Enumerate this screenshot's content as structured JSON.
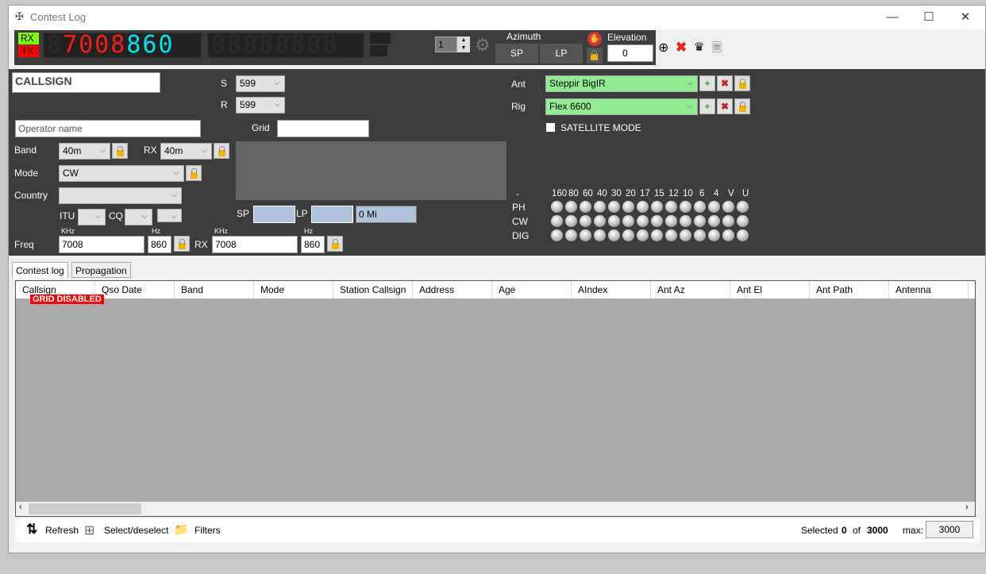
{
  "window": {
    "title": "Contest Log",
    "minimize": "—",
    "maximize": "☐",
    "close": "✕"
  },
  "toolbar": {
    "rx": "RX",
    "tx": "TX",
    "freq_khz": "7008",
    "freq_hz": "860",
    "spinner": "1",
    "azimuth": "Azimuth",
    "sp": "SP",
    "lp": "LP",
    "elevation": "Elevation",
    "elevation_value": "0"
  },
  "entry": {
    "callsign_placeholder": "CALLSIGN",
    "operator_placeholder": "Operator name",
    "s_label": "S",
    "s_value": "599",
    "r_label": "R",
    "r_value": "599",
    "grid_label": "Grid",
    "grid_value": "",
    "band_label": "Band",
    "band_value": "40m",
    "rx_label": "RX",
    "rx_band_value": "40m",
    "mode_label": "Mode",
    "mode_value": "CW",
    "country_label": "Country",
    "country_value": "",
    "itu_label": "ITU",
    "cq_label": "CQ",
    "sp_label": "SP",
    "lp_label": "LP",
    "distance": "0 Mi",
    "freq_label": "Freq",
    "khz": "KHz",
    "hz": "Hz",
    "freq_khz": "7008",
    "freq_hz": "860",
    "rx_freq_label": "RX",
    "rx_freq_khz": "7008",
    "rx_freq_hz": "860"
  },
  "station": {
    "ant_label": "Ant",
    "ant_value": "Steppir BigIR",
    "rig_label": "Rig",
    "rig_value": "Flex 6600",
    "satellite_mode": "SATELLITE MODE"
  },
  "band_matrix": {
    "corner": "-",
    "bands": [
      "160",
      "80",
      "60",
      "40",
      "30",
      "20",
      "17",
      "15",
      "12",
      "10",
      "6",
      "4",
      "V",
      "U"
    ],
    "modes": [
      "PH",
      "CW",
      "DIG"
    ]
  },
  "tabs": [
    {
      "label": "Contest log",
      "active": true
    },
    {
      "label": "Propagation",
      "active": false
    }
  ],
  "grid": {
    "columns": [
      "Callsign",
      "Qso Date",
      "Band",
      "Mode",
      "Station Callsign",
      "Address",
      "Age",
      "AIndex",
      "Ant Az",
      "Ant El",
      "Ant Path",
      "Antenna"
    ],
    "badge": "GRID DISABLED"
  },
  "footer": {
    "refresh": "Refresh",
    "select": "Select/deselect",
    "filters": "Filters",
    "selected_label": "Selected",
    "selected": "0",
    "of": "of",
    "total": "3000",
    "max_label": "max:",
    "max_value": "3000"
  },
  "colors": {
    "panel": "#3c3c3c",
    "rx": "#7cfc00",
    "tx": "#ff0000",
    "freq_khz": "#ff1a1a",
    "freq_hz": "#00e5ee",
    "green_field": "#90ee90",
    "badge": "#ff0000"
  }
}
